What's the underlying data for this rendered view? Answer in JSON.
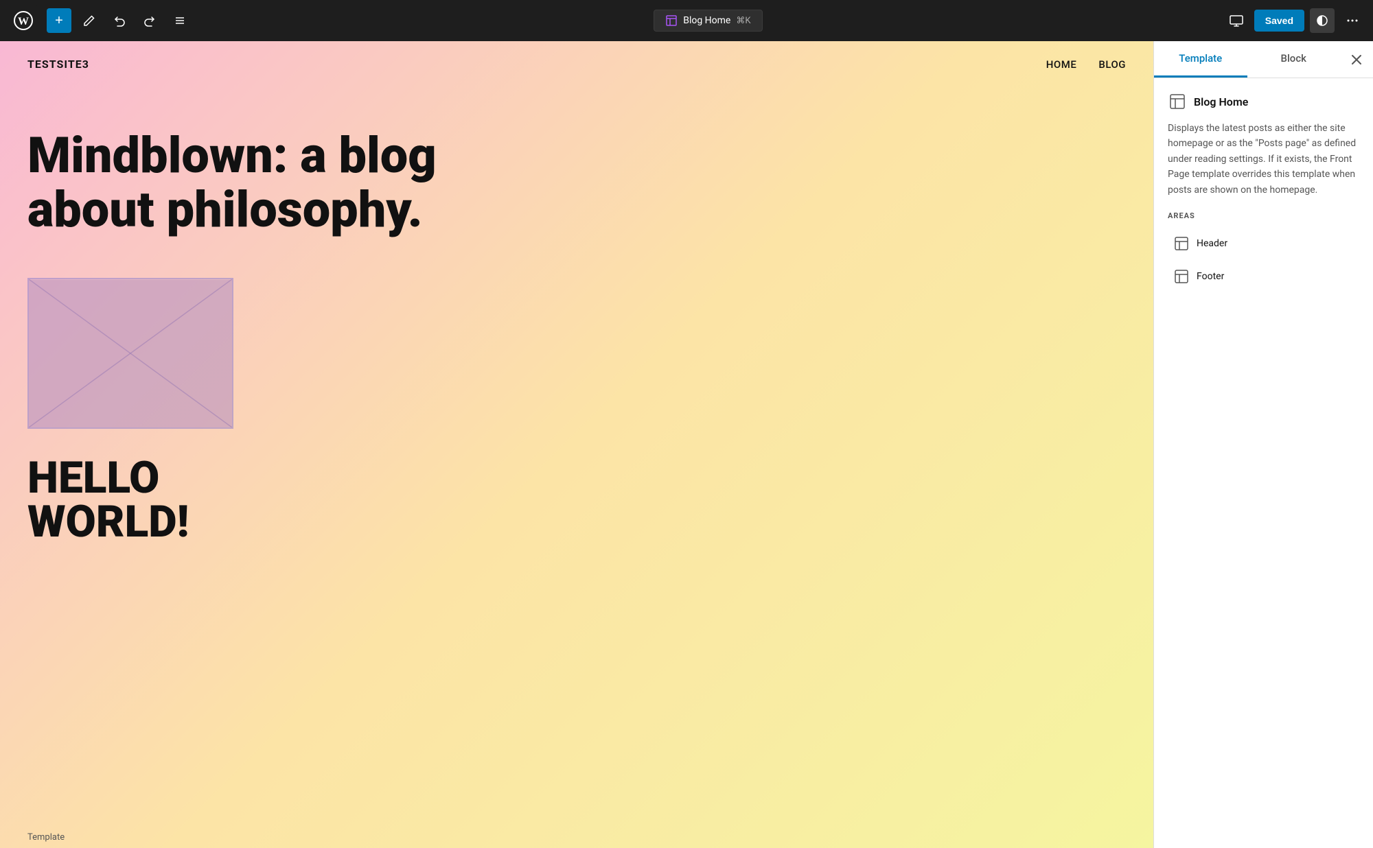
{
  "toolbar": {
    "add_label": "+",
    "blog_home_label": "Blog Home",
    "keyboard_shortcut": "⌘K",
    "saved_label": "Saved"
  },
  "canvas": {
    "site_title": "TESTSITE3",
    "nav_items": [
      "HOME",
      "BLOG"
    ],
    "hero_text": "Mindblown: a blog about philosophy.",
    "post_title": "HELLO WORLD!",
    "template_label": "Template"
  },
  "panel": {
    "tab_template": "Template",
    "tab_block": "Block",
    "title": "Blog Home",
    "description": "Displays the latest posts as either the site homepage or as the \"Posts page\" as defined under reading settings. If it exists, the Front Page template overrides this template when posts are shown on the homepage.",
    "areas_label": "AREAS",
    "areas": [
      {
        "label": "Header",
        "icon": "layout-icon"
      },
      {
        "label": "Footer",
        "icon": "layout-icon"
      }
    ]
  }
}
